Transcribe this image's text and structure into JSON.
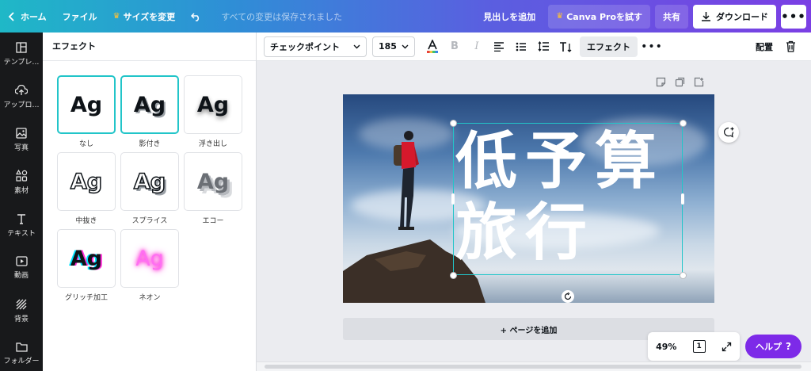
{
  "topbar": {
    "home": "ホーム",
    "file": "ファイル",
    "resize": "サイズを変更",
    "saved_status": "すべての変更は保存されました",
    "add_heading": "見出しを追加",
    "canva_pro": "Canva Proを試す",
    "share": "共有",
    "download": "ダウンロード",
    "more": "•••",
    "brand_gradient": [
      "#1fb8c7",
      "#7b3fe4"
    ]
  },
  "rail": {
    "items": [
      {
        "label": "テンプレ…",
        "icon": "template-icon"
      },
      {
        "label": "アップロ…",
        "icon": "upload-icon"
      },
      {
        "label": "写真",
        "icon": "photo-icon"
      },
      {
        "label": "素材",
        "icon": "elements-icon"
      },
      {
        "label": "テキスト",
        "icon": "text-icon"
      },
      {
        "label": "動画",
        "icon": "video-icon"
      },
      {
        "label": "背景",
        "icon": "background-icon"
      },
      {
        "label": "フォルダー",
        "icon": "folder-icon"
      }
    ]
  },
  "panel": {
    "title": "エフェクト",
    "sample": "Ag",
    "effects": [
      {
        "label": "なし",
        "selected": false
      },
      {
        "label": "影付き",
        "selected": true
      },
      {
        "label": "浮き出し",
        "selected": false
      },
      {
        "label": "中抜き",
        "selected": false
      },
      {
        "label": "スプライス",
        "selected": false
      },
      {
        "label": "エコー",
        "selected": false
      },
      {
        "label": "グリッチ加工",
        "selected": false
      },
      {
        "label": "ネオン",
        "selected": false
      }
    ]
  },
  "toolbar": {
    "font": "チェックポイント",
    "size": "185",
    "text_color": "#0e1318",
    "effects": "エフェクト",
    "more": "•••",
    "arrange": "配置"
  },
  "design": {
    "line1": "低予算",
    "line2": "旅行",
    "text_color": "#ffffff",
    "selection_color": "#22c5c9"
  },
  "canvas": {
    "add_page": "+ ページを追加",
    "zoom": "49%",
    "page_count": "1",
    "help": "ヘルプ",
    "help_icon": "?",
    "help_color": "#7d2ae8"
  }
}
